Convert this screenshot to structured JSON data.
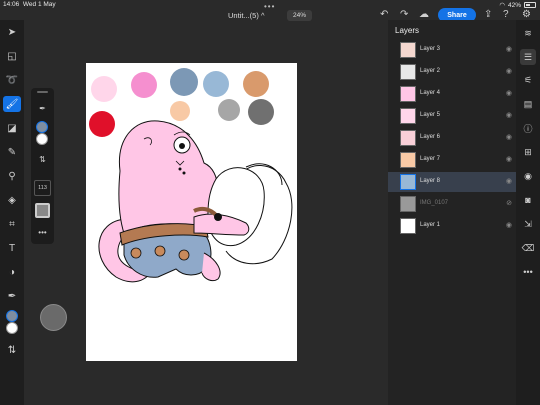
{
  "status": {
    "time": "14:06",
    "date": "Wed 1 May",
    "battery": "42%",
    "battery_level": 0.42
  },
  "header": {
    "dots": "•••",
    "title": "Untit...(5)",
    "title_caret": "^",
    "zoom": "24%",
    "share_label": "Share"
  },
  "layers": {
    "title": "Layers",
    "items": [
      {
        "name": "Layer 3",
        "visible": true
      },
      {
        "name": "Layer 2",
        "visible": true
      },
      {
        "name": "Layer 4",
        "visible": true
      },
      {
        "name": "Layer 5",
        "visible": true
      },
      {
        "name": "Layer 6",
        "visible": true
      },
      {
        "name": "Layer 7",
        "visible": true
      },
      {
        "name": "Layer 8",
        "visible": true,
        "selected": true
      },
      {
        "name": "IMG_0107",
        "visible": false
      },
      {
        "name": "Layer 1",
        "visible": true
      }
    ]
  },
  "brush": {
    "size": "113"
  },
  "colors": {
    "accent": "#1473e6",
    "primary_swatch": "#7f8ea0",
    "secondary_swatch": "#ffffff",
    "palette": [
      "#ffd6ea",
      "#f58fcf",
      "#7c98b5",
      "#98b8d6",
      "#d99a6c",
      "#e0102a",
      "#f8c9a5",
      "#a6a6a6",
      "#707070"
    ]
  }
}
